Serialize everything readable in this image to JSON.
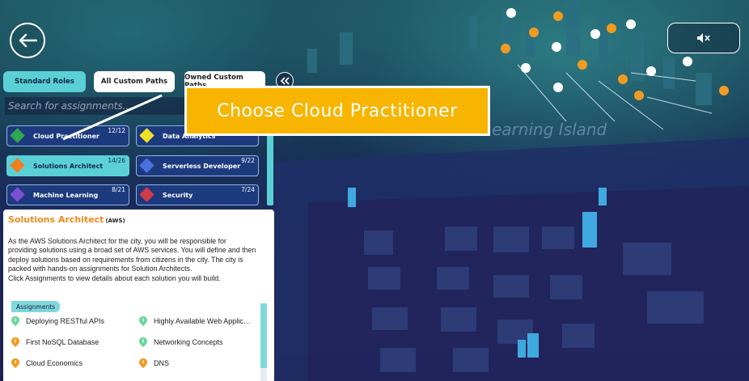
{
  "colors": {
    "accent": "#5ad0d6",
    "callout": "#f7b500",
    "title_orange": "#ef8a1d"
  },
  "tabs": [
    {
      "label": "Standard Roles",
      "active": true
    },
    {
      "label": "All Custom Paths",
      "active": false
    },
    {
      "label": "Owned Custom Paths",
      "active": false
    }
  ],
  "search": {
    "placeholder": "Search for assignments..."
  },
  "roles": [
    {
      "name": "Cloud Practitioner",
      "progress": "12/12",
      "gem": "#2fa84f",
      "active": false
    },
    {
      "name": "Data Analytics",
      "progress": "",
      "gem": "#f1e02a",
      "active": false
    },
    {
      "name": "Solutions Architect",
      "progress": "14/26",
      "gem": "#f07f1e",
      "active": true
    },
    {
      "name": "Serverless Developer",
      "progress": "9/22",
      "gem": "#4a6fe0",
      "active": false
    },
    {
      "name": "Machine Learning",
      "progress": "8/21",
      "gem": "#7a4fd0",
      "active": false
    },
    {
      "name": "Security",
      "progress": "7/24",
      "gem": "#d23a4a",
      "active": false
    }
  ],
  "callout": {
    "text": "Choose Cloud Practitioner"
  },
  "island_label": "earning Island",
  "info": {
    "title": "Solutions Architect",
    "badge": "(AWS)",
    "description": [
      "As the AWS Solutions Architect for the city, you will be responsible for",
      "providing solutions using a broad set of AWS services. You will define and then",
      "deploy solutions based on requirements from citizens in the city. The city is",
      "packed with hands-on assignments for Solution Architects.",
      " Click Assignments to view details about each solution you will build."
    ],
    "assignments_label": "Assignments",
    "assignments": [
      "Deploying RESTful APIs",
      "Highly Available Web Applic…",
      "First NoSQL Database",
      "Networking Concepts",
      "Cloud Economics",
      "DNS"
    ]
  },
  "icons": {
    "back": "arrow-left-icon",
    "mute": "speaker-muted-icon",
    "collapse": "double-chevron-left-icon"
  }
}
